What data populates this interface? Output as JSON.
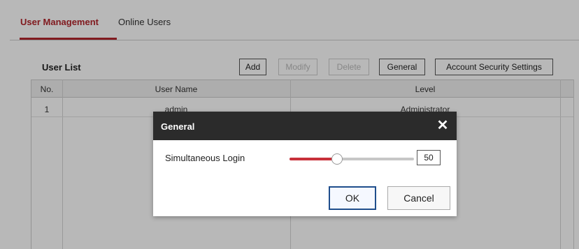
{
  "tabs": [
    {
      "label": "User Management",
      "active": true
    },
    {
      "label": "Online Users",
      "active": false
    }
  ],
  "user_list": {
    "title": "User List",
    "buttons": {
      "add": "Add",
      "modify": "Modify",
      "delete": "Delete",
      "general": "General",
      "account_security": "Account Security Settings"
    },
    "columns": [
      "No.",
      "User Name",
      "Level"
    ],
    "rows": [
      {
        "no": "1",
        "user_name": "admin",
        "level": "Administrator"
      }
    ]
  },
  "dialog": {
    "title": "General",
    "close_icon": "close-icon",
    "simultaneous_login": {
      "label": "Simultaneous Login",
      "value": "50",
      "level_fraction": 0.38
    },
    "ok_label": "OK",
    "cancel_label": "Cancel"
  },
  "colors": {
    "accent": "#b3262d",
    "dialog_header": "#2b2b2b",
    "slider_fill": "#c8303a"
  }
}
